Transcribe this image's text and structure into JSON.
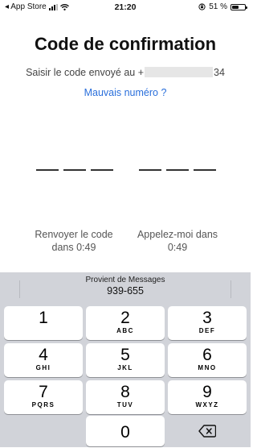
{
  "status_bar": {
    "back_app": "◂ App Store",
    "time": "21:20",
    "battery_percent": "51 %",
    "battery_level": 0.51
  },
  "screen": {
    "title": "Code de confirmation",
    "subtitle_prefix": "Saisir le code envoyé au +",
    "subtitle_suffix": "34",
    "wrong_number_link": "Mauvais numéro ?",
    "resend_label": "Renvoyer le code",
    "resend_timer": "dans 0:49",
    "call_label": "Appelez-moi dans",
    "call_timer": "0:49"
  },
  "keyboard": {
    "suggestion_title": "Provient de Messages",
    "suggestion_code": "939-655",
    "keys": [
      {
        "num": "1",
        "letters": ""
      },
      {
        "num": "2",
        "letters": "ABC"
      },
      {
        "num": "3",
        "letters": "DEF"
      },
      {
        "num": "4",
        "letters": "GHI"
      },
      {
        "num": "5",
        "letters": "JKL"
      },
      {
        "num": "6",
        "letters": "MNO"
      },
      {
        "num": "7",
        "letters": "PQRS"
      },
      {
        "num": "8",
        "letters": "TUV"
      },
      {
        "num": "9",
        "letters": "WXYZ"
      },
      {
        "num": "0",
        "letters": ""
      }
    ],
    "delete_icon": "delete-backspace-icon"
  },
  "colors": {
    "link": "#2a6fdb",
    "keyboard_bg": "#d1d3d9"
  }
}
